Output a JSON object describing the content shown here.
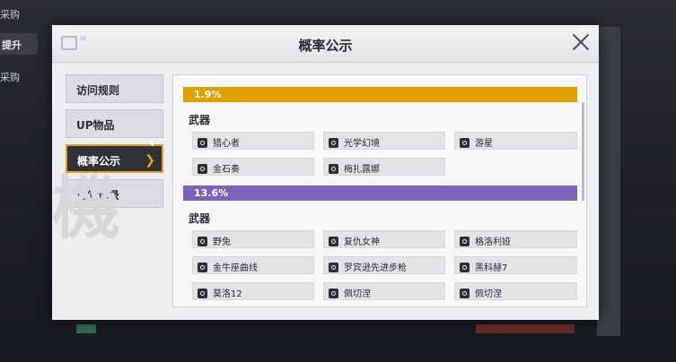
{
  "background": {
    "side_items": [
      "采购",
      "提升",
      "采购"
    ]
  },
  "modal": {
    "title": "概率公示",
    "logo_text": "SII",
    "menu": [
      {
        "label": "访问规则",
        "active": false
      },
      {
        "label": "UP物品",
        "active": false
      },
      {
        "label": "概率公示",
        "active": true
      },
      {
        "label": "访问记录",
        "active": false
      }
    ],
    "watermark": "機",
    "sections": [
      {
        "rate": "1.9%",
        "color": "#e0a100",
        "category": "武器",
        "items": [
          "猎心者",
          "光学幻境",
          "游星",
          "金石奏",
          "梅扎露娜"
        ]
      },
      {
        "rate": "13.6%",
        "color": "#7d62bd",
        "category": "武器",
        "items": [
          "野兔",
          "复仇女神",
          "格洛利娅",
          "金牛座曲线",
          "罗宾逊先进步枪",
          "黑科赫7",
          "莫洛12",
          "佩切涅",
          "佩切涅"
        ]
      }
    ]
  }
}
